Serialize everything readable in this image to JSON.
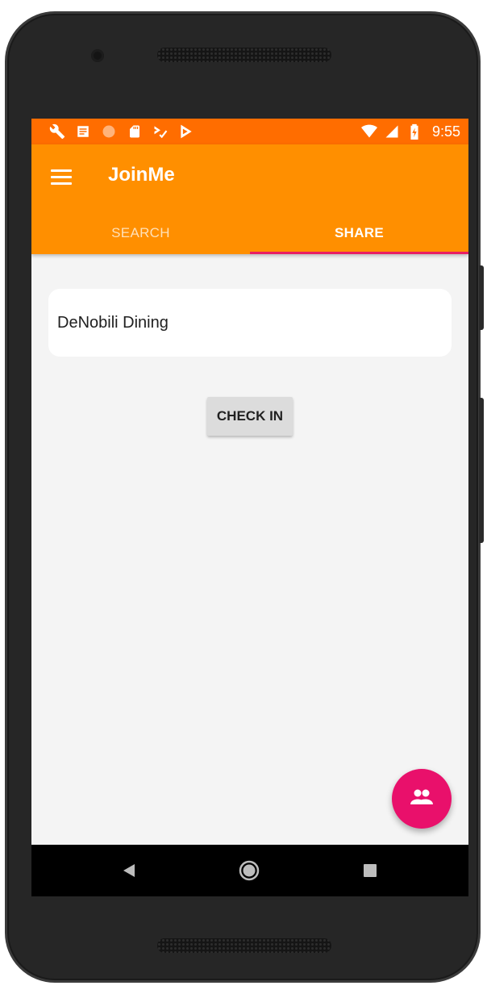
{
  "status_bar": {
    "time": "9:55",
    "left_icons": [
      "wrench-icon",
      "note-icon",
      "circle-icon",
      "sd-card-icon",
      "check-arrow-icon",
      "play-store-icon"
    ],
    "right_icons": [
      "wifi-icon",
      "signal-icon",
      "battery-charging-icon"
    ],
    "color": "#ff6d00"
  },
  "app_bar": {
    "title": "JoinMe",
    "menu_icon": "hamburger-menu-icon",
    "color": "#ff8f00"
  },
  "tabs": [
    {
      "label": "SEARCH",
      "active": false
    },
    {
      "label": "SHARE",
      "active": true
    }
  ],
  "tab_indicator_color": "#e91e63",
  "content": {
    "location_text": "DeNobili Dining",
    "check_in_label": "CHECK IN"
  },
  "fab": {
    "icon": "people-icon",
    "color": "#e9106b"
  },
  "nav_bar": {
    "back_icon": "back-triangle-icon",
    "home_icon": "home-circle-icon",
    "recents_icon": "recents-square-icon"
  }
}
